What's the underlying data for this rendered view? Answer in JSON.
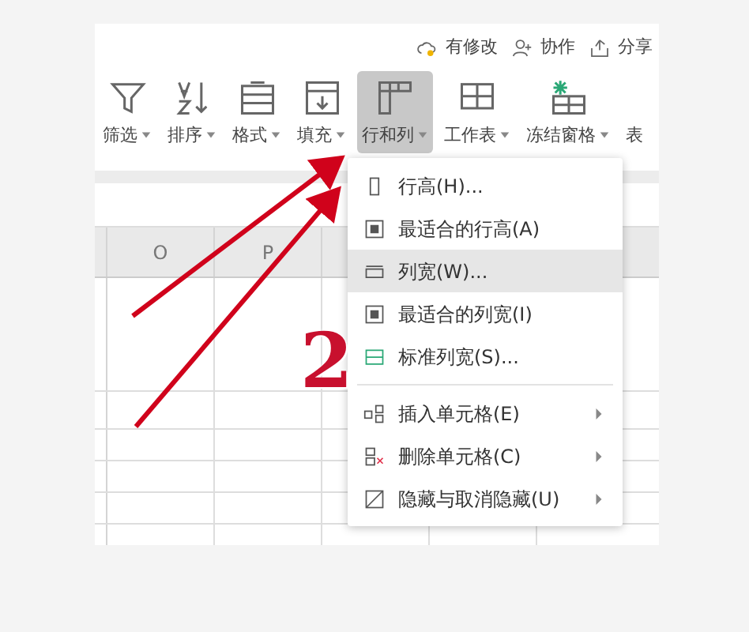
{
  "top_actions": [
    {
      "kind": "cloud",
      "label": "有修改"
    },
    {
      "kind": "person",
      "label": "协作"
    },
    {
      "kind": "share",
      "label": "分享"
    }
  ],
  "toolbar": [
    {
      "kind": "filter",
      "label": "筛选",
      "selected": false
    },
    {
      "kind": "sort",
      "label": "排序",
      "selected": false
    },
    {
      "kind": "format",
      "label": "格式",
      "selected": false
    },
    {
      "kind": "fill",
      "label": "填充",
      "selected": false
    },
    {
      "kind": "rowcol",
      "label": "行和列",
      "selected": true
    },
    {
      "kind": "sheet",
      "label": "工作表",
      "selected": false
    },
    {
      "kind": "freeze",
      "label": "冻结窗格",
      "selected": false
    },
    {
      "kind": "none",
      "label": "表",
      "selected": false
    }
  ],
  "columns": [
    "O",
    "P"
  ],
  "menu": {
    "sections": [
      [
        {
          "kind": "rowheight",
          "label": "行高(H)...",
          "submenu": false,
          "selected": false
        },
        {
          "kind": "autofit",
          "label": "最适合的行高(A)",
          "submenu": false,
          "selected": false
        },
        {
          "kind": "colwidth",
          "label": "列宽(W)...",
          "submenu": false,
          "selected": true
        },
        {
          "kind": "autofit",
          "label": "最适合的列宽(I)",
          "submenu": false,
          "selected": false
        },
        {
          "kind": "stdwidth",
          "label": "标准列宽(S)...",
          "submenu": false,
          "selected": false
        }
      ],
      [
        {
          "kind": "insert",
          "label": "插入单元格(E)",
          "submenu": true,
          "selected": false
        },
        {
          "kind": "delete",
          "label": "删除单元格(C)",
          "submenu": true,
          "selected": false
        },
        {
          "kind": "hide",
          "label": "隐藏与取消隐藏(U)",
          "submenu": true,
          "selected": false
        }
      ]
    ]
  },
  "annotation": {
    "step": "2"
  }
}
